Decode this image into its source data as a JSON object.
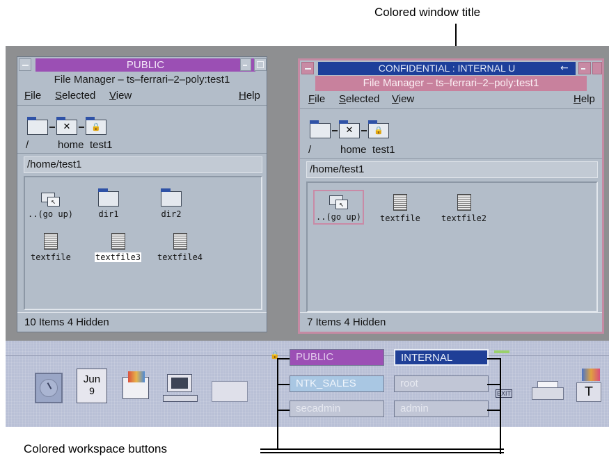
{
  "callouts": {
    "top": "Colored window title",
    "bottom": "Colored workspace buttons"
  },
  "colors": {
    "public_label": "#9b4fb4",
    "confidential_label": "#1d3f9a",
    "confidential_subtitle": "#c8819d",
    "confidential_frame": "#c58aa3",
    "public_ws": "#9c4fb5",
    "internal_ws": "#1f3f97",
    "ntk_sales_ws": "#a9c7e3"
  },
  "left_window": {
    "label": "PUBLIC",
    "title": "File Manager – ts–ferrari–2–poly:test1",
    "menu": {
      "file": "File",
      "selected": "Selected",
      "view": "View",
      "help": "Help"
    },
    "path_segments": {
      "root": "/",
      "home": "home",
      "leaf": "test1"
    },
    "path_field": "/home/test1",
    "files": [
      {
        "name": "..(go up)",
        "icon": "go-up-icon"
      },
      {
        "name": "dir1",
        "icon": "folder-icon"
      },
      {
        "name": "dir2",
        "icon": "folder-icon"
      },
      {
        "name": "textfile",
        "icon": "document-icon"
      },
      {
        "name": "textfile3",
        "icon": "document-icon",
        "selected": true
      },
      {
        "name": "textfile4",
        "icon": "document-icon"
      }
    ],
    "status": "10 Items 4 Hidden"
  },
  "right_window": {
    "label": "CONFIDENTIAL : INTERNAL U",
    "title": "File Manager – ts–ferrari–2–poly:test1",
    "menu": {
      "file": "File",
      "selected": "Selected",
      "view": "View",
      "help": "Help"
    },
    "path_segments": {
      "root": "/",
      "home": "home",
      "leaf": "test1"
    },
    "path_field": "/home/test1",
    "files": [
      {
        "name": "..(go up)",
        "icon": "go-up-icon",
        "focused": true
      },
      {
        "name": "textfile",
        "icon": "document-icon"
      },
      {
        "name": "textfile2",
        "icon": "document-icon"
      }
    ],
    "status": "7 Items 4 Hidden"
  },
  "front_panel": {
    "calendar": {
      "month": "Jun",
      "day": "9"
    },
    "workspaces": [
      {
        "label": "PUBLIC"
      },
      {
        "label": "INTERNAL"
      },
      {
        "label": "NTK_SALES"
      },
      {
        "label": "root"
      },
      {
        "label": "secadmin"
      },
      {
        "label": "admin"
      }
    ],
    "exit_label": "EXIT"
  }
}
